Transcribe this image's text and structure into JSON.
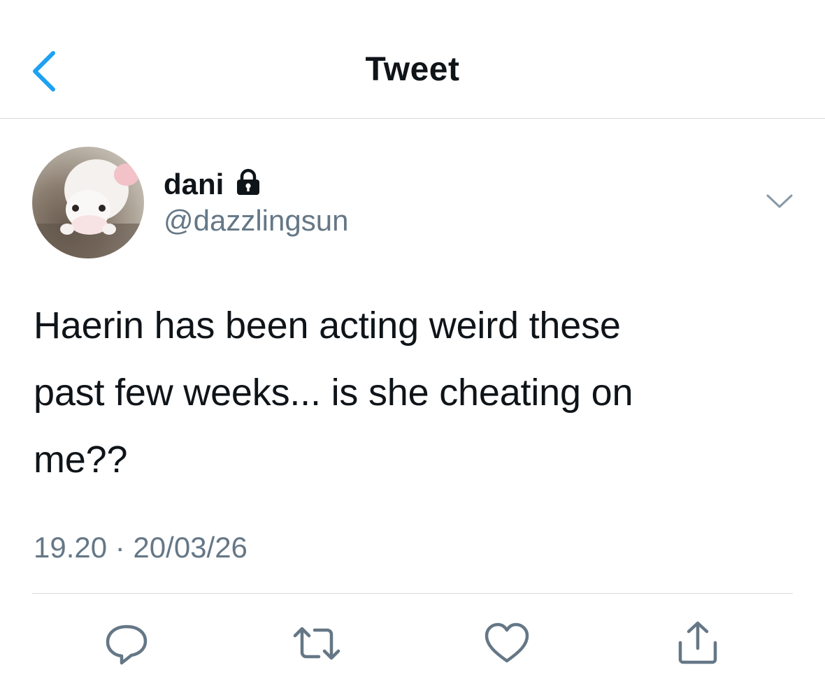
{
  "header": {
    "title": "Tweet",
    "back_icon": "chevron-left-icon"
  },
  "tweet": {
    "author": {
      "display_name": "dani",
      "handle": "@dazzlingsun",
      "protected_icon": "lock-icon"
    },
    "text_lines": [
      "Haerin has been acting weird these",
      "past few weeks... is she cheating on",
      "me??"
    ],
    "timestamp": "19.20 · 20/03/26",
    "menu_icon": "chevron-down-icon",
    "actions": [
      {
        "name": "reply",
        "icon": "reply-icon"
      },
      {
        "name": "retweet",
        "icon": "retweet-icon"
      },
      {
        "name": "like",
        "icon": "heart-icon"
      },
      {
        "name": "share",
        "icon": "share-icon"
      }
    ]
  },
  "colors": {
    "accent": "#1da1f2",
    "text_primary": "#0f1419",
    "text_secondary": "#657786",
    "divider": "#d6d9dc"
  }
}
